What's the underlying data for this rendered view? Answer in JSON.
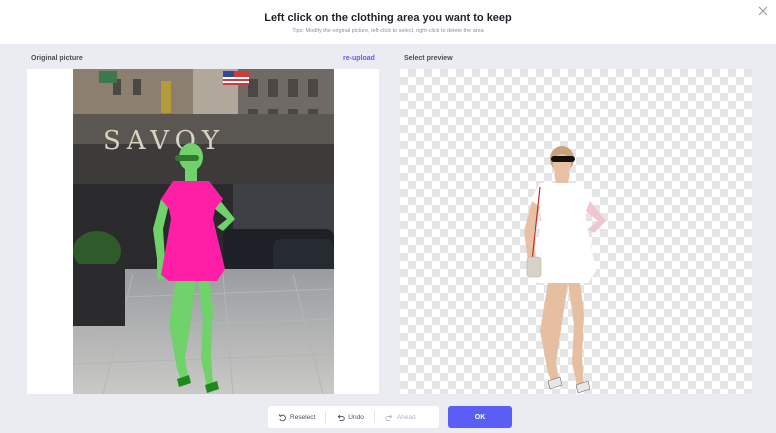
{
  "header": {
    "title": "Left click on the clothing area you want to keep",
    "tips": "Tips: Modify the original picture, left-click to select, right-click to delete the area"
  },
  "original": {
    "label": "Original picture",
    "reupload": "re-upload",
    "sign_text": "SAVOY"
  },
  "preview": {
    "label": "Select preview"
  },
  "toolbar": {
    "reselect": "Reselect",
    "undo": "Undo",
    "ahead": "Ahead"
  },
  "ok_label": "OK",
  "colors": {
    "accent": "#5b5ef5",
    "selection_pink": "#ff1fa6",
    "mask_green": "#6fd26a"
  }
}
